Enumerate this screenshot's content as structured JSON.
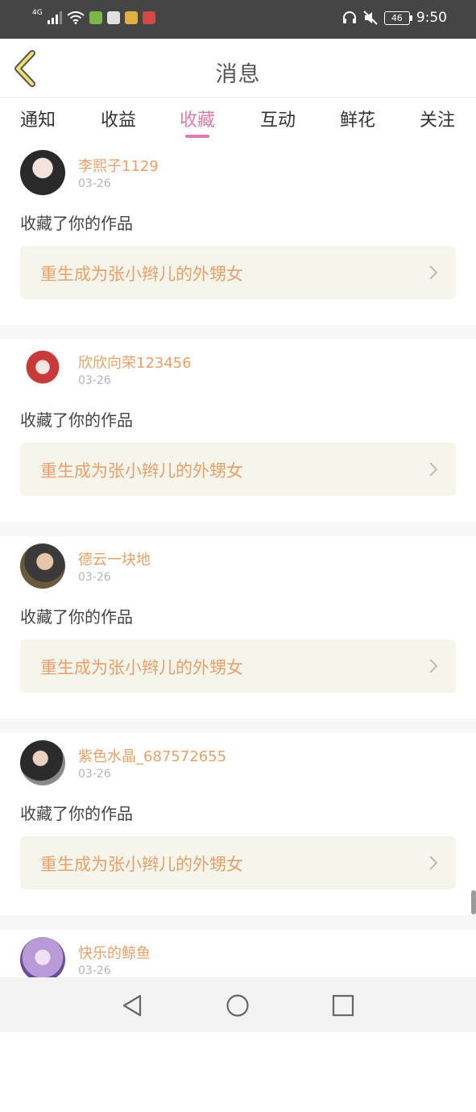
{
  "status_bar": {
    "network": "4G",
    "battery": "46",
    "time": "9:50"
  },
  "header": {
    "title": "消息",
    "back_icon": "chevron-left-icon"
  },
  "tabs": [
    {
      "label": "通知"
    },
    {
      "label": "收益"
    },
    {
      "label": "收藏",
      "active": true
    },
    {
      "label": "互动"
    },
    {
      "label": "鲜花"
    },
    {
      "label": "关注"
    }
  ],
  "feed": {
    "items": [
      {
        "username": "李熙子1129",
        "date": "03-26",
        "action": "收藏了你的作品",
        "work_title": "重生成为张小辫儿的外甥女"
      },
      {
        "username": "欣欣向荣123456",
        "date": "03-26",
        "action": "收藏了你的作品",
        "work_title": "重生成为张小辫儿的外甥女"
      },
      {
        "username": "德云一块地",
        "date": "03-26",
        "action": "收藏了你的作品",
        "work_title": "重生成为张小辫儿的外甥女"
      },
      {
        "username": "紫色水晶_687572655",
        "date": "03-26",
        "action": "收藏了你的作品",
        "work_title": "重生成为张小辫儿的外甥女"
      },
      {
        "username": "快乐的鲸鱼",
        "date": "03-26"
      }
    ]
  },
  "colors": {
    "accent": "#e07aa8",
    "username": "#e8a06a",
    "link_bg": "#f5f5ec",
    "status_bar": "#454545"
  }
}
